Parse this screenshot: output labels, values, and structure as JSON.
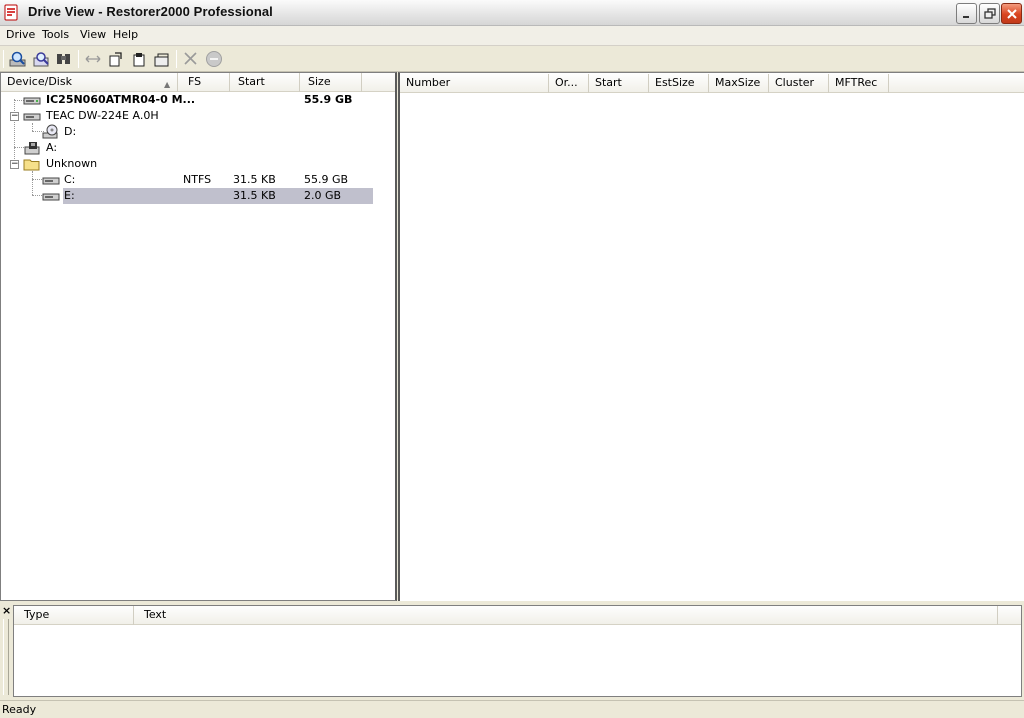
{
  "window": {
    "title": "Drive View - Restorer2000 Professional"
  },
  "menu": [
    "Drive",
    "Tools",
    "View",
    "Help"
  ],
  "toolbar": {
    "icons": [
      "scan-drive-icon",
      "scan-image-icon",
      "find-icon",
      "connect-icon",
      "open-file-icon",
      "save-file-icon",
      "export-icon",
      "cancel-icon",
      "stop-icon"
    ]
  },
  "tree": {
    "columns": [
      "Device/Disk",
      "FS",
      "Start",
      "Size"
    ],
    "rows": [
      {
        "name": "IC25N060ATMR04-0 M...",
        "fs": "",
        "start": "",
        "size": "55.9 GB"
      },
      {
        "name": "TEAC DW-224E A.0H",
        "fs": "",
        "start": "",
        "size": ""
      },
      {
        "name": "D:",
        "fs": "",
        "start": "",
        "size": ""
      },
      {
        "name": "A:",
        "fs": "",
        "start": "",
        "size": ""
      },
      {
        "name": "Unknown",
        "fs": "",
        "start": "",
        "size": ""
      },
      {
        "name": "C:",
        "fs": "NTFS",
        "start": "31.5 KB",
        "size": "55.9 GB"
      },
      {
        "name": "E:",
        "fs": "",
        "start": "31.5 KB",
        "size": "2.0 GB"
      }
    ]
  },
  "files": {
    "columns": [
      "Number",
      "Or...",
      "Start",
      "EstSize",
      "MaxSize",
      "Cluster",
      "MFTRec"
    ]
  },
  "log": {
    "close_label": "×",
    "columns": [
      "Type",
      "Text"
    ]
  },
  "status": {
    "text": "Ready"
  }
}
